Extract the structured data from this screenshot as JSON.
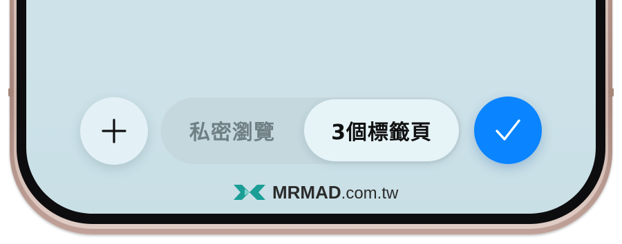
{
  "toolbar": {
    "new_tab_icon": "plus-icon",
    "segments": [
      {
        "label": "私密瀏覽",
        "selected": false
      },
      {
        "label": "3個標籤頁",
        "selected": true
      }
    ],
    "done_icon": "checkmark-icon"
  },
  "watermark": {
    "brand": "MRMAD",
    "domain": ".com.tw"
  },
  "colors": {
    "accent": "#0a84ff",
    "screen_background": "#cde2e9",
    "watermark_logo": "#1a9e96"
  }
}
